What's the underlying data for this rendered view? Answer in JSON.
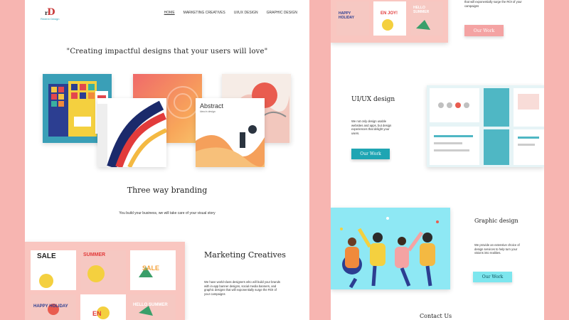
{
  "brand": {
    "mark": "D",
    "mark_prefix": "r",
    "name": "Redem Design"
  },
  "nav": {
    "items": [
      "HOME",
      "MARKETING CREATIVES",
      "UI/UX DESIGN",
      "GRAPHIC DESIGN"
    ]
  },
  "hero": {
    "quote": "\"Creating impactful designs that your users will love\""
  },
  "branding": {
    "title": "Three way branding",
    "subtitle": "You build your business, we will take care of your visual story",
    "abstract_card_title": "Abstract",
    "abstract_card_sub": "Idea in design"
  },
  "marketing": {
    "title": "Marketing Creatives",
    "body": "We have world-class designers who will build your brands with in-app banner designs, social media banners, and graphic designs that will exponentially surge the ROI of your campaigns",
    "tiles": [
      "SALE",
      "SUMMER",
      "SALE",
      "HAPPY HOLIDAY",
      "EN",
      "HELLO SUMMER"
    ]
  },
  "right_top": {
    "body_tail": "that will exponentially surge the ROI of your campaigns",
    "button": "Our Work",
    "tiles": [
      "HAPPY HOLIDAY",
      "EN JOY!",
      "HELLO SUMMER"
    ]
  },
  "uiux": {
    "title": "UI/UX design",
    "body": "We not only design usable websites and apps, but design experiences that delight your users.",
    "button": "Our Work"
  },
  "graphic": {
    "title": "Graphic design",
    "body": "We provide an extensive choice of design services to help turn your visions into realities.",
    "button": "Our Work"
  },
  "contact": {
    "title": "Contact Us"
  },
  "colors": {
    "background": "#f7b5b1",
    "pink_button": "#f4a3a3",
    "teal_button": "#1fa5b3",
    "cyan_button": "#7de6ee",
    "graphic_bg": "#8ee8f4"
  }
}
